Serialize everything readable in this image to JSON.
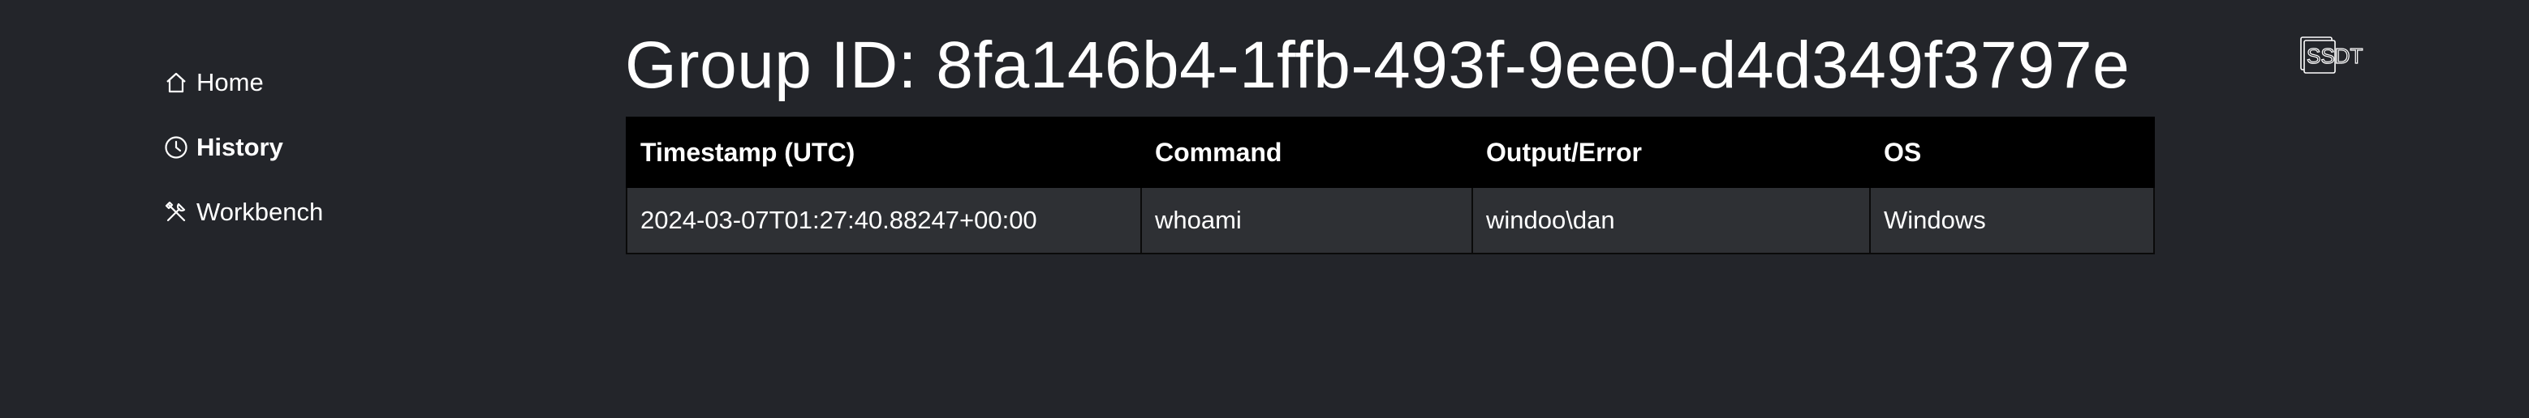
{
  "sidebar": {
    "items": [
      {
        "label": "Home",
        "icon": "home-icon",
        "active": false
      },
      {
        "label": "History",
        "icon": "clock-icon",
        "active": true
      },
      {
        "label": "Workbench",
        "icon": "tools-icon",
        "active": false
      }
    ]
  },
  "header": {
    "title": "Group ID: 8fa146b4-1ffb-493f-9ee0-d4d349f3797e"
  },
  "logo": {
    "text": "SSDT"
  },
  "table": {
    "headers": [
      "Timestamp (UTC)",
      "Command",
      "Output/Error",
      "OS"
    ],
    "rows": [
      [
        "2024-03-07T01:27:40.88247+00:00",
        "whoami",
        "windoo\\dan",
        "Windows"
      ]
    ]
  },
  "colors": {
    "background": "#23252a",
    "table_header": "#000000",
    "table_row": "#2e3034",
    "text": "#ffffff"
  }
}
